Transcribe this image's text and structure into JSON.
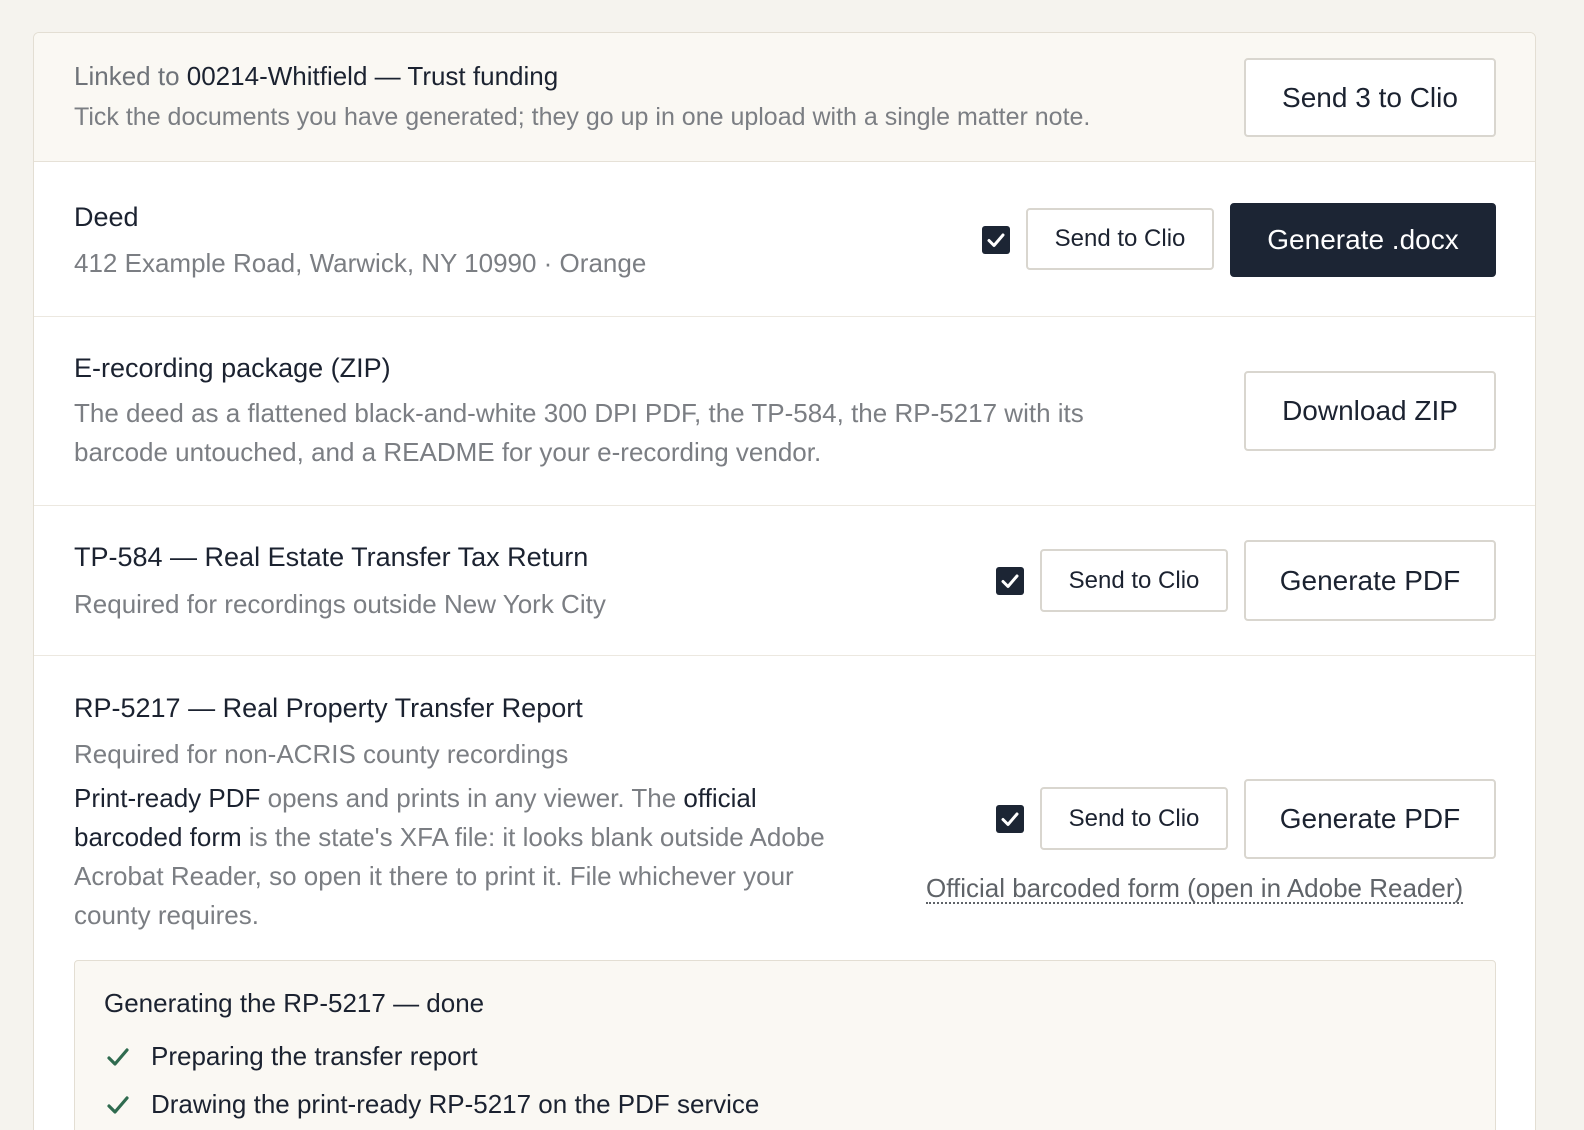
{
  "header": {
    "linked_prefix": "Linked to",
    "matter": "00214-Whitfield — Trust funding",
    "description": "Tick the documents you have generated; they go up in one upload with a single matter note.",
    "send_all_label": "Send 3 to Clio"
  },
  "deed": {
    "title": "Deed",
    "subtitle": "412 Example Road, Warwick, NY 10990 · Orange",
    "checked": true,
    "send_label": "Send to Clio",
    "generate_label": "Generate .docx"
  },
  "erecording": {
    "title": "E-recording package (ZIP)",
    "description_line1": "The deed as a flattened black-and-white 300 DPI PDF, the TP-584, the RP-5217 with its",
    "description_line2": "barcode untouched, and a README for your e-recording vendor.",
    "download_label": "Download ZIP"
  },
  "tp584": {
    "title": "TP-584 — Real Estate Transfer Tax Return",
    "subtitle": "Required for recordings outside New York City",
    "checked": true,
    "send_label": "Send to Clio",
    "generate_label": "Generate PDF"
  },
  "rp5217": {
    "title": "RP-5217 — Real Property Transfer Report",
    "subtitle": "Required for non-ACRIS county recordings",
    "note_bold1": "Print-ready PDF",
    "note_text1": " opens and prints in any viewer. The ",
    "note_bold2a": "official",
    "note_bold2b": "barcoded form",
    "note_text2": " is the state's XFA file: it looks blank outside Adobe",
    "note_line3": "Acrobat Reader, so open it there to print it. File whichever your",
    "note_line4": "county requires.",
    "checked": true,
    "send_label": "Send to Clio",
    "generate_label": "Generate PDF",
    "official_link": "Official barcoded form (open in Adobe Reader)"
  },
  "status": {
    "title": "Generating the RP-5217 — done",
    "steps": [
      "Preparing the transfer report",
      "Drawing the print-ready RP-5217 on the PDF service"
    ]
  },
  "colors": {
    "page_bg": "#f5f3ee",
    "accent_dark": "#1c2534",
    "check_green": "#2f6b4f"
  }
}
